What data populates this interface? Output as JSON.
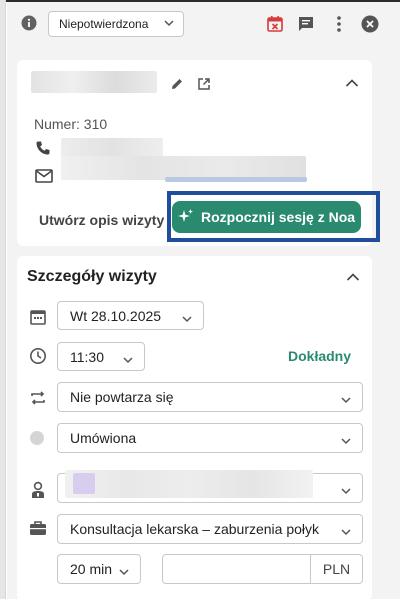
{
  "toolbar": {
    "info_icon": "info-icon",
    "status_value": "Niepotwierdzona",
    "calendar_cancel_icon": "calendar-x-icon",
    "chat_icon": "chat-icon",
    "more_icon": "more-vertical-icon",
    "close_icon": "close-icon"
  },
  "patient_card": {
    "number_label": "Numer: 310",
    "edit_icon": "pencil-icon",
    "open_icon": "open-in-new-icon",
    "collapse_icon": "chevron-up-icon",
    "phone_icon": "phone-icon",
    "email_icon": "email-icon",
    "create_description_label": "Utwórz opis wizyty",
    "noa_button_label": "Rozpocznij sesję z Noa",
    "noa_icon": "sparkle-icon"
  },
  "visit_details": {
    "title": "Szczegóły wizyty",
    "date_value": "Wt 28.10.2025",
    "time_value": "11:30",
    "exact_label": "Dokładny",
    "repeat_value": "Nie powtarza się",
    "status_value": "Umówiona",
    "service_value": "Konsultacja lekarska – zaburzenia połyk",
    "duration_value": "20 min",
    "currency_label": "PLN"
  },
  "colors": {
    "accent": "#2a8a70",
    "highlight_border": "#1f4e9c",
    "cancel_red": "#d93a3a"
  }
}
